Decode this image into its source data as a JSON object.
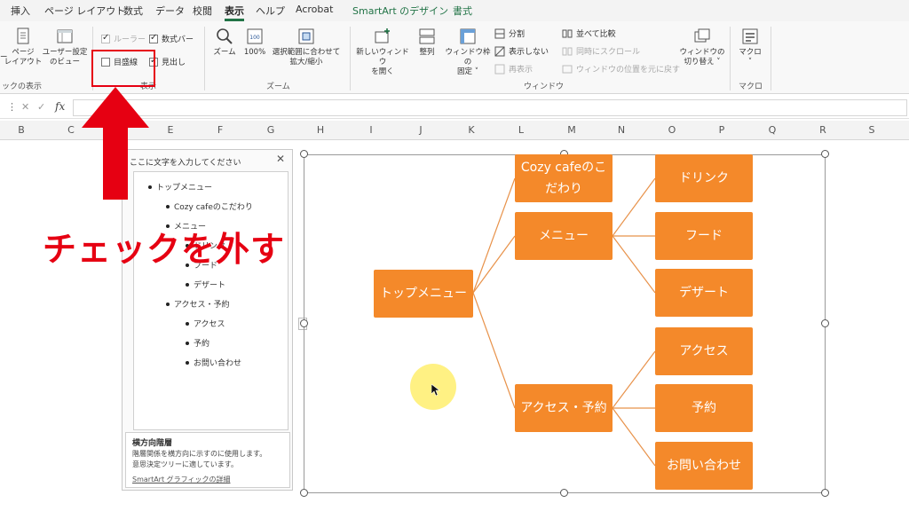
{
  "ribbon": {
    "tabs": [
      {
        "label": "挿入"
      },
      {
        "label": "ページ レイアウト"
      },
      {
        "label": "数式"
      },
      {
        "label": "データ"
      },
      {
        "label": "校閲"
      },
      {
        "label": "表示",
        "active": true
      },
      {
        "label": "ヘルプ"
      },
      {
        "label": "Acrobat"
      },
      {
        "label": "SmartArt のデザイン"
      },
      {
        "label": "書式"
      }
    ],
    "workbook_views": {
      "page_layout": "ページ\nレイアウト",
      "custom_view": "ユーザー設定\nのビュー",
      "group_label": "ックの表示",
      "left_fragment": "ー"
    },
    "show": {
      "ruler": {
        "label": "ルーラー",
        "checked": true,
        "disabled": true
      },
      "formula_bar": {
        "label": "数式バー",
        "checked": true
      },
      "gridlines": {
        "label": "目盛線",
        "checked": false
      },
      "headings": {
        "label": "見出し",
        "checked": true
      },
      "group_label": "表示"
    },
    "zoom": {
      "zoom": "ズーム",
      "hundred": "100%",
      "zoom_to_selection": "選択範囲に合わせて\n拡大/縮小",
      "icon_number": "100",
      "group_label": "ズーム"
    },
    "window": {
      "new_window": "新しいウィンドウ\nを開く",
      "arrange_all": "整列",
      "freeze_panes": "ウィンドウ枠の\n固定 ˅",
      "split": "分割",
      "hide": "表示しない",
      "unhide": "再表示",
      "side_by_side": "並べて比較",
      "sync_scroll": "同時にスクロール",
      "reset_position": "ウィンドウの位置を元に戻す",
      "switch_windows": "ウィンドウの\n切り替え ˅",
      "group_label": "ウィンドウ"
    },
    "macros": {
      "macro": "マクロ\n˅",
      "group_label": "マクロ"
    }
  },
  "formula_bar": {
    "menu": "⋮",
    "cancel": "✕",
    "enter": "✓",
    "fx": "fx"
  },
  "columns": [
    "B",
    "C",
    "D",
    "E",
    "F",
    "G",
    "H",
    "I",
    "J",
    "K",
    "L",
    "M",
    "N",
    "O",
    "P",
    "Q",
    "R",
    "S"
  ],
  "text_pane": {
    "title": "ここに文字を入力してください",
    "close": "✕",
    "items": [
      {
        "text": "トップメニュー"
      },
      {
        "text": "Cozy cafeのこだわり"
      },
      {
        "text": "メニュー"
      },
      {
        "text": "ドリンク"
      },
      {
        "text": "フード"
      },
      {
        "text": "デザート"
      },
      {
        "text": "アクセス・予約"
      },
      {
        "text": "アクセス"
      },
      {
        "text": "予約"
      },
      {
        "text": "お問い合わせ"
      }
    ],
    "desc_title": "横方向階層",
    "desc_line1": "階層関係を横方向に示すのに使用します。",
    "desc_line2": "意思決定ツリーに適しています。",
    "desc_link": "SmartArt グラフィックの詳細"
  },
  "smartart": {
    "colors": {
      "fill": "#f4892a",
      "line": "#e8924a",
      "text": "#ffffff"
    },
    "nodes": [
      {
        "label": "トップメニュー"
      },
      {
        "label": "Cozy cafeのこだわり"
      },
      {
        "label": "メニュー"
      },
      {
        "label": "アクセス・予約"
      },
      {
        "label": "ドリンク"
      },
      {
        "label": "フード"
      },
      {
        "label": "デザート"
      },
      {
        "label": "アクセス"
      },
      {
        "label": "予約"
      },
      {
        "label": "お問い合わせ"
      }
    ]
  },
  "annotation": {
    "text": "チェックを外す",
    "color": "#e60012"
  }
}
